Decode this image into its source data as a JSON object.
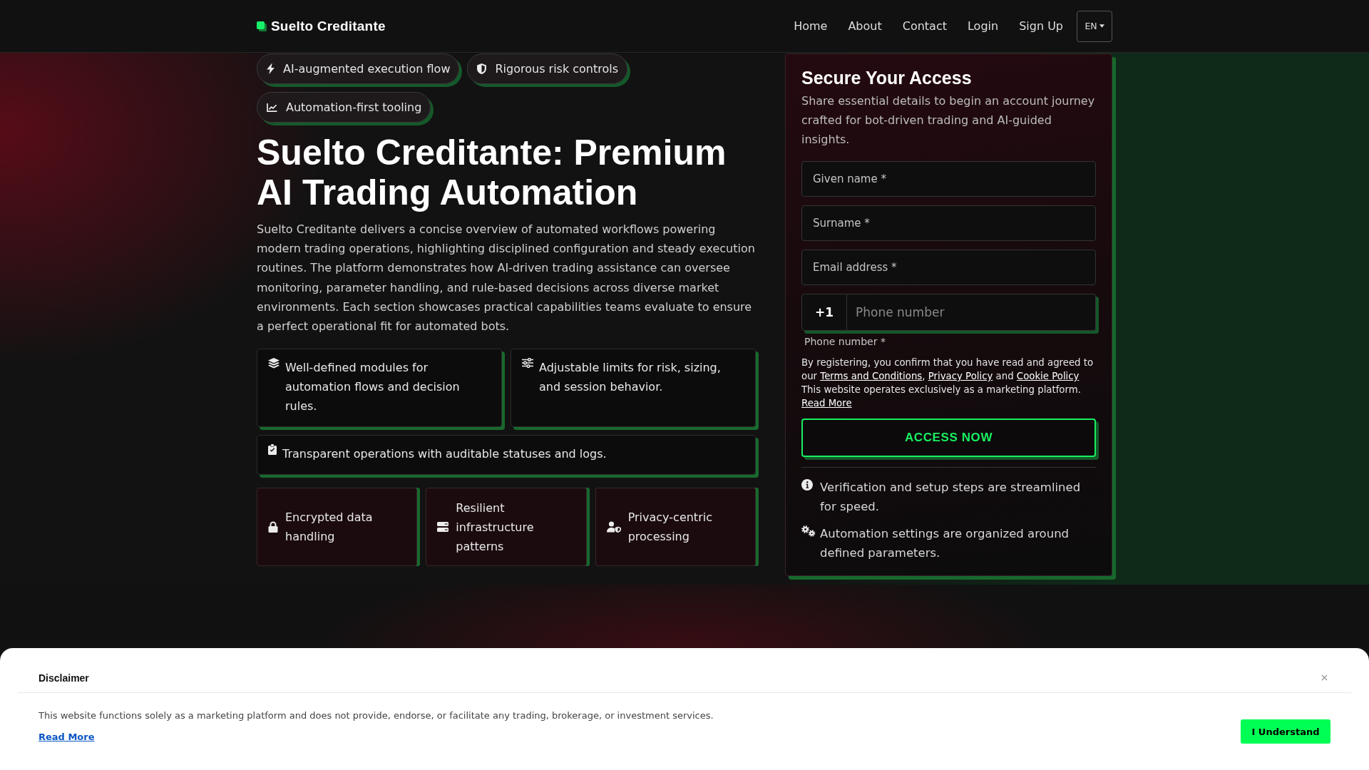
{
  "header": {
    "brand": "Suelto Creditante",
    "nav": [
      "Home",
      "About",
      "Contact",
      "Login",
      "Sign Up"
    ],
    "language": "EN"
  },
  "hero": {
    "chips": [
      "AI-augmented execution flow",
      "Rigorous risk controls",
      "Automation-first tooling"
    ],
    "title": "Suelto Creditante: Premium AI Trading Automation",
    "description": "Suelto Creditante delivers a concise overview of automated workflows powering modern trading operations, highlighting disciplined configuration and steady execution routines. The platform demonstrates how AI-driven trading assistance can oversee monitoring, parameter handling, and rule-based decisions across diverse market environments. Each section showcases practical capabilities teams evaluate to ensure a perfect operational fit for automated bots.",
    "features": [
      "Well-defined modules for automation flows and decision rules.",
      "Adjustable limits for risk, sizing, and session behavior.",
      "Transparent operations with auditable statuses and logs."
    ],
    "highlights": [
      "Encrypted data handling",
      "Resilient infrastructure patterns",
      "Privacy-centric processing"
    ]
  },
  "signup": {
    "title": "Secure Your Access",
    "description": "Share essential details to begin an account journey crafted for bot-driven trading and AI-guided insights.",
    "fields": [
      {
        "placeholder": "Given name *"
      },
      {
        "placeholder": "Surname *"
      },
      {
        "placeholder": "Email address *"
      }
    ],
    "phone": {
      "prefix": "+1",
      "placeholder": "Phone number",
      "label": "Phone number *"
    },
    "consent": [
      {
        "kind": "text",
        "text": "By registering, you confirm that you have read and agreed to our "
      },
      {
        "kind": "link",
        "text": "Terms and Conditions"
      },
      {
        "kind": "text",
        "text": ", "
      },
      {
        "kind": "link",
        "text": "Privacy Policy"
      },
      {
        "kind": "text",
        "text": " and "
      },
      {
        "kind": "link",
        "text": "Cookie Policy"
      },
      {
        "kind": "text",
        "text": " This website operates exclusively as a marketing platform. "
      },
      {
        "kind": "link",
        "text": "Read More"
      }
    ],
    "submit": "ACCESS NOW",
    "notes": [
      "Verification and setup steps are streamlined for speed.",
      "Automation settings are organized around defined parameters."
    ]
  },
  "disclaimer": {
    "title": "Disclaimer",
    "text": "This website functions solely as a marketing platform and does not provide, endorse, or facilitate any trading, brokerage, or investment services.",
    "link": "Read More",
    "button": "I Understand"
  }
}
